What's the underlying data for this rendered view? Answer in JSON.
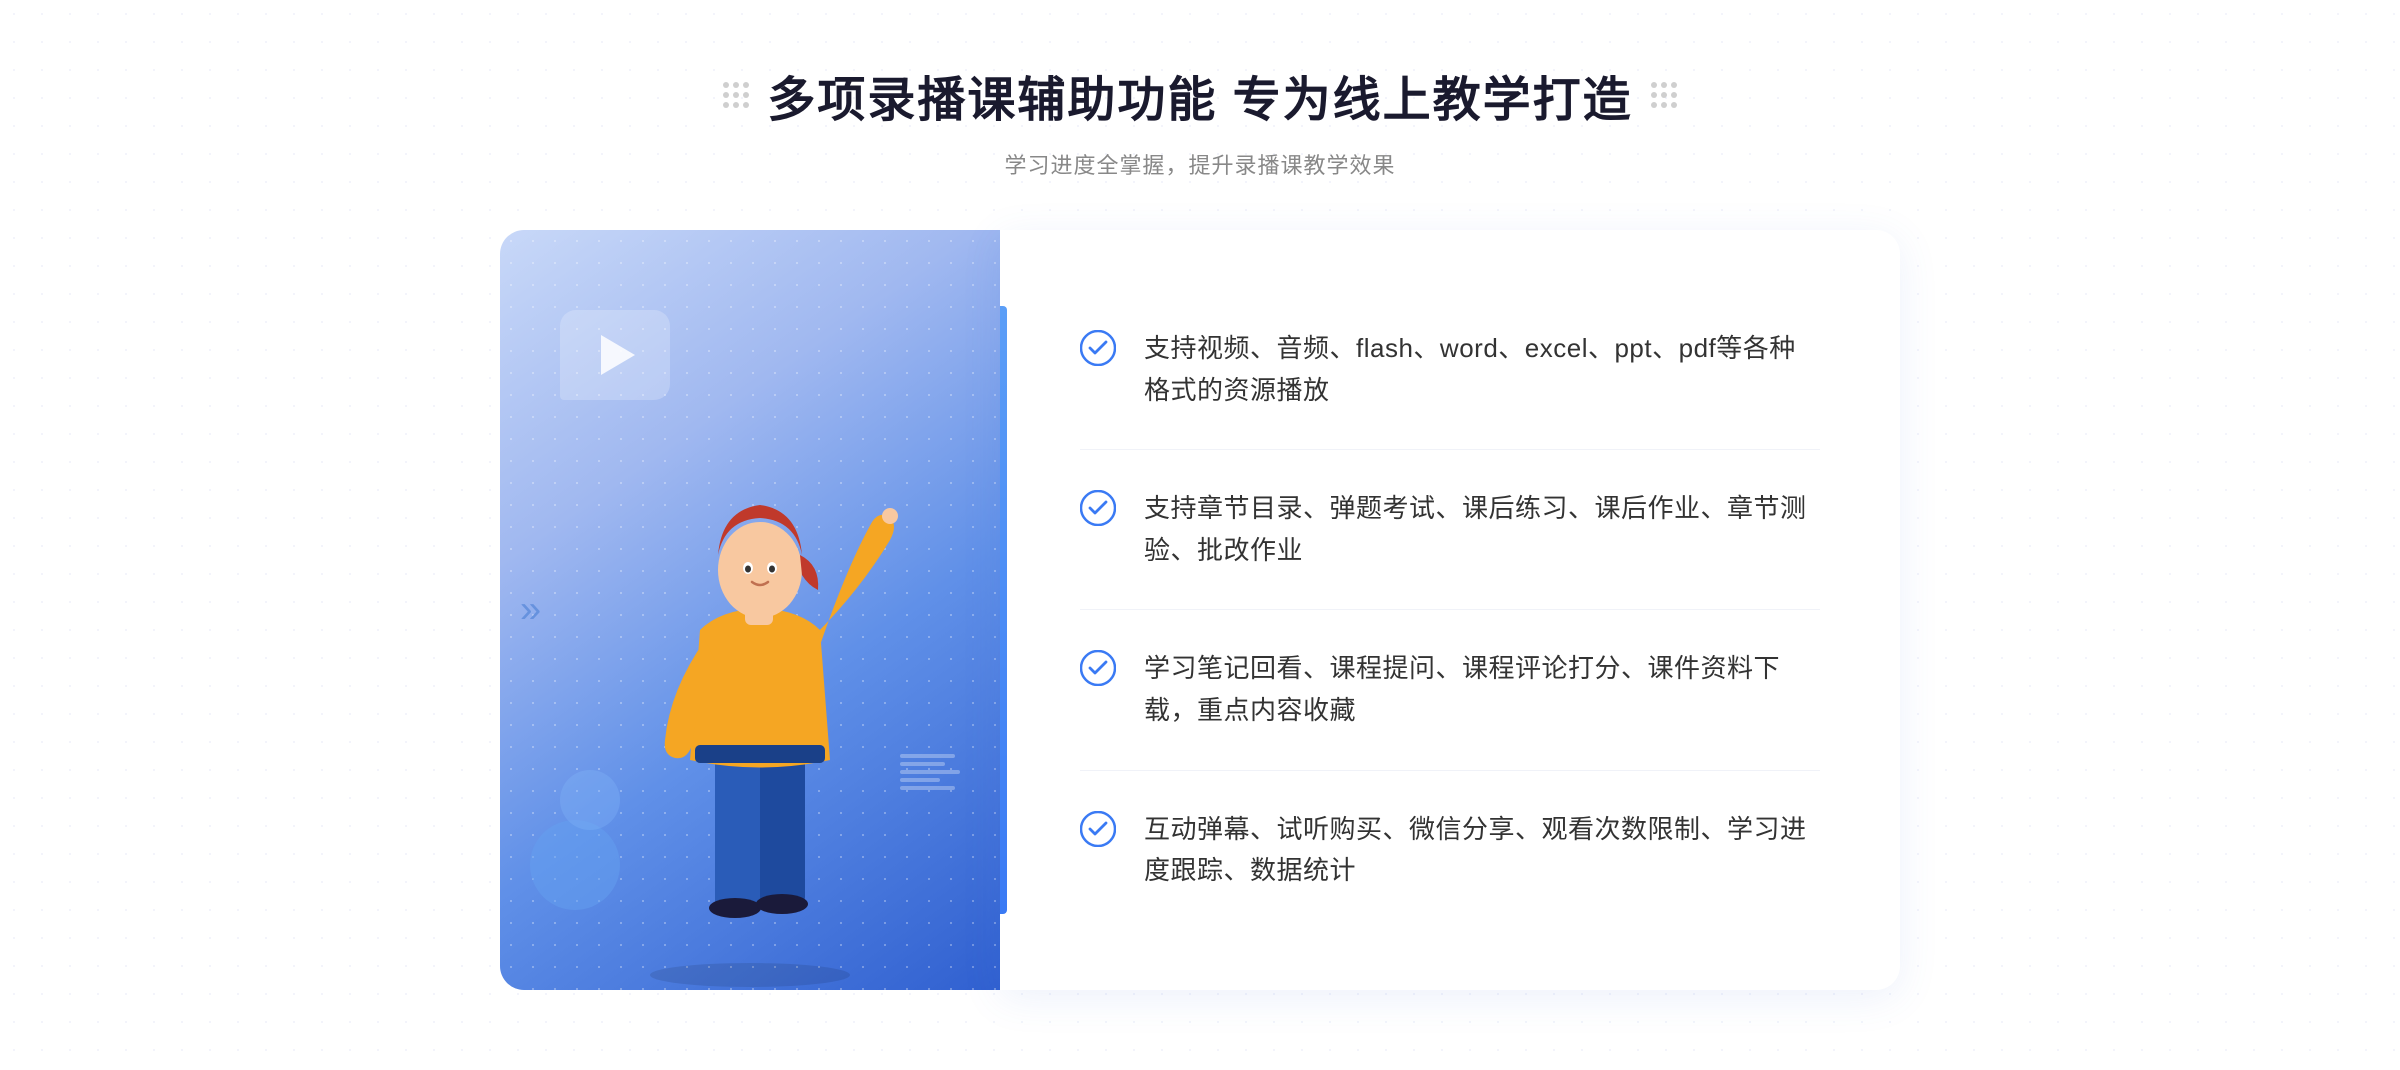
{
  "header": {
    "title": "多项录播课辅助功能 专为线上教学打造",
    "subtitle": "学习进度全掌握，提升录播课教学效果"
  },
  "features": [
    {
      "id": "feature-1",
      "text": "支持视频、音频、flash、word、excel、ppt、pdf等各种格式的资源播放"
    },
    {
      "id": "feature-2",
      "text": "支持章节目录、弹题考试、课后练习、课后作业、章节测验、批改作业"
    },
    {
      "id": "feature-3",
      "text": "学习笔记回看、课程提问、课程评论打分、课件资料下载，重点内容收藏"
    },
    {
      "id": "feature-4",
      "text": "互动弹幕、试听购买、微信分享、观看次数限制、学习进度跟踪、数据统计"
    }
  ],
  "colors": {
    "accent": "#3a7af4",
    "text_primary": "#1a1a2e",
    "text_secondary": "#888888",
    "check_color": "#3a7af4"
  },
  "left_chevron": "»"
}
